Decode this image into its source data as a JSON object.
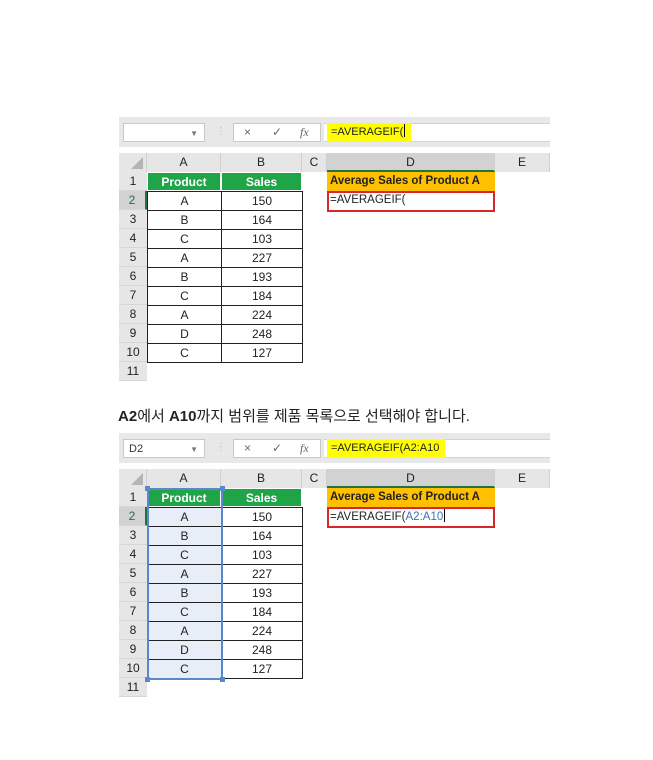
{
  "screens": [
    {
      "name_box": "",
      "formula_buttons": {
        "cancel": "×",
        "enter": "✓",
        "fx": "fx"
      },
      "formula_text": "=AVERAGEIF(",
      "formula_ref": "",
      "columns": [
        "A",
        "B",
        "C",
        "D",
        "E"
      ],
      "selected_column": "D",
      "rows": [
        "1",
        "2",
        "3",
        "4",
        "5",
        "6",
        "7",
        "8",
        "9",
        "10",
        "11"
      ],
      "selected_row": "2",
      "table_headers": {
        "product": "Product",
        "sales": "Sales"
      },
      "table_rows": [
        {
          "product": "A",
          "sales": "150"
        },
        {
          "product": "B",
          "sales": "164"
        },
        {
          "product": "C",
          "sales": "103"
        },
        {
          "product": "A",
          "sales": "227"
        },
        {
          "product": "B",
          "sales": "193"
        },
        {
          "product": "C",
          "sales": "184"
        },
        {
          "product": "A",
          "sales": "224"
        },
        {
          "product": "D",
          "sales": "248"
        },
        {
          "product": "C",
          "sales": "127"
        }
      ],
      "avg_header": "Average Sales of Product A",
      "edit_cell_text": "=AVERAGEIF(",
      "edit_cell_ref": ""
    },
    {
      "name_box": "D2",
      "formula_buttons": {
        "cancel": "×",
        "enter": "✓",
        "fx": "fx"
      },
      "formula_text": "=AVERAGEIF(A2:A10",
      "formula_ref": "",
      "columns": [
        "A",
        "B",
        "C",
        "D",
        "E"
      ],
      "selected_column": "D",
      "rows": [
        "1",
        "2",
        "3",
        "4",
        "5",
        "6",
        "7",
        "8",
        "9",
        "10",
        "11"
      ],
      "selected_row": "2",
      "table_headers": {
        "product": "Product",
        "sales": "Sales"
      },
      "table_rows": [
        {
          "product": "A",
          "sales": "150"
        },
        {
          "product": "B",
          "sales": "164"
        },
        {
          "product": "C",
          "sales": "103"
        },
        {
          "product": "A",
          "sales": "227"
        },
        {
          "product": "B",
          "sales": "193"
        },
        {
          "product": "C",
          "sales": "184"
        },
        {
          "product": "A",
          "sales": "224"
        },
        {
          "product": "D",
          "sales": "248"
        },
        {
          "product": "C",
          "sales": "127"
        }
      ],
      "avg_header": "Average Sales of Product A",
      "edit_cell_text": "=AVERAGEIF(",
      "edit_cell_ref": "A2:A10",
      "selected_range": "A2:A10"
    }
  ],
  "caption": {
    "part1": "A2",
    "part2": "에서 ",
    "part3": "A10",
    "part4": "까지 범위를 제품 목록으로 선택해야 합니다."
  },
  "colors": {
    "header_green": "#1fa448",
    "avg_header_orange": "#ffc000",
    "formula_highlight": "#ffff00",
    "edit_border_red": "#d9262a",
    "range_blue": "#3d6fb6"
  }
}
